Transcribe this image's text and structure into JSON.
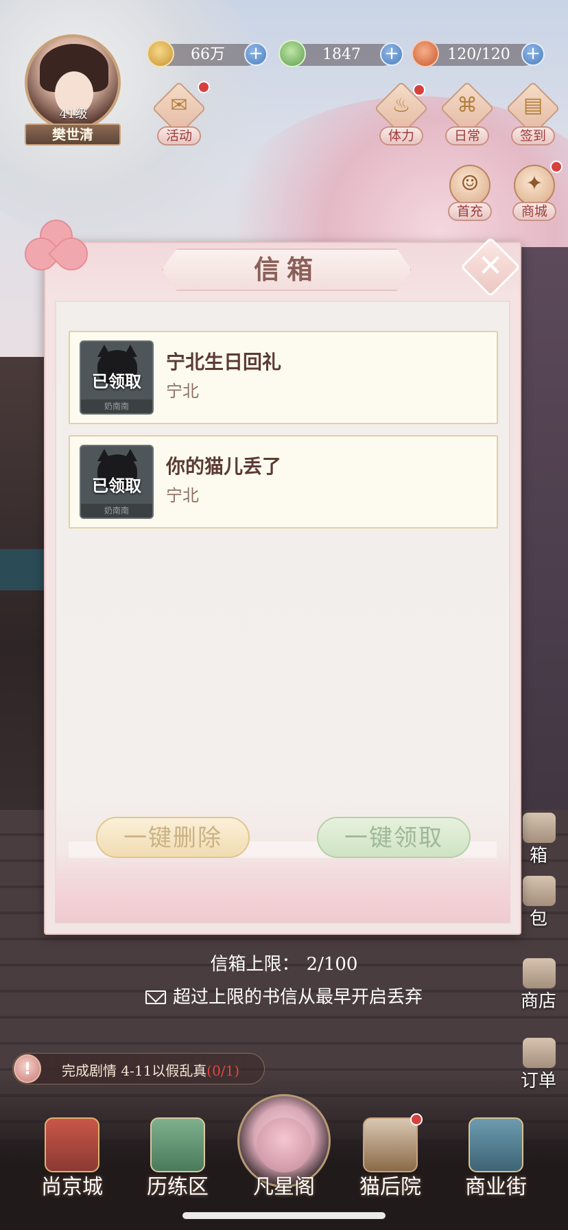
{
  "player": {
    "level": "41级",
    "name": "樊世清"
  },
  "currencies": [
    {
      "icon": "paw-coin-icon",
      "value": "66万"
    },
    {
      "icon": "jade-icon",
      "value": "1847"
    },
    {
      "icon": "stamina-food-icon",
      "value": "120/120"
    }
  ],
  "hud_buttons": {
    "activity": "活动",
    "stamina": "体力",
    "daily": "日常",
    "checkin": "签到",
    "first_charge": "首充",
    "mall": "商城"
  },
  "mailbox": {
    "title": "信箱",
    "mails": [
      {
        "title": "宁北生日回礼",
        "sender": "宁北",
        "status": "已领取",
        "thumb_tag": "奶南南"
      },
      {
        "title": "你的猫儿丢了",
        "sender": "宁北",
        "status": "已领取",
        "thumb_tag": "奶南南"
      }
    ],
    "delete_all": "一键删除",
    "claim_all": "一键领取",
    "limit_label": "信箱上限：",
    "limit_value": "2/100",
    "discard_note": "超过上限的书信从最早开启丢弃"
  },
  "side_menu": {
    "mailbox": "箱",
    "bag": "包",
    "shop": "商店",
    "orders": "订单"
  },
  "quest": {
    "icon": "!",
    "text": "完成剧情 4-11以假乱真",
    "progress": "(0/1)"
  },
  "bottom_nav": [
    {
      "label": "尚京城",
      "icon": "palace-icon"
    },
    {
      "label": "历练区",
      "icon": "mountain-icon"
    },
    {
      "label": "凡星阁",
      "icon": "sakura-tree-icon"
    },
    {
      "label": "猫后院",
      "icon": "cat-basket-icon"
    },
    {
      "label": "商业街",
      "icon": "gate-icon"
    }
  ],
  "colors": {
    "title_text": "#8b5f59",
    "mail_title": "#5b3b33",
    "badge_red": "#d6403d",
    "quest_progress": "#e0483f"
  }
}
